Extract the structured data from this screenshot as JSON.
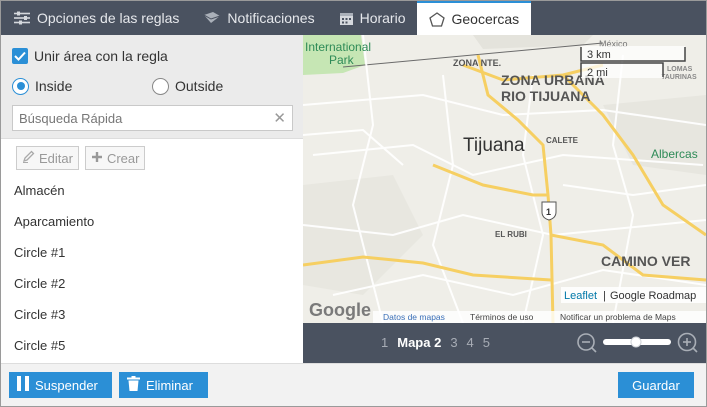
{
  "tabs": [
    {
      "label": "Opciones de las reglas",
      "icon": "sliders-icon",
      "active": false
    },
    {
      "label": "Notificaciones",
      "icon": "envelope-icon",
      "active": false
    },
    {
      "label": "Horario",
      "icon": "calendar-icon",
      "active": false
    },
    {
      "label": "Geocercas",
      "icon": "pentagon-icon",
      "active": true
    }
  ],
  "form": {
    "join_area_label": "Unir área con la regla",
    "join_area_checked": true,
    "inside_label": "Inside",
    "outside_label": "Outside",
    "selected_mode": "inside",
    "search_placeholder": "Búsqueda Rápida"
  },
  "toolbar": {
    "edit_label": "Editar",
    "create_label": "Crear"
  },
  "geofences": [
    {
      "label": "Almacén"
    },
    {
      "label": "Aparcamiento"
    },
    {
      "label": "Circle #1"
    },
    {
      "label": "Circle #2"
    },
    {
      "label": "Circle #3"
    },
    {
      "label": "Circle #5"
    }
  ],
  "map": {
    "labels": {
      "park": "International Park",
      "zona_nte": "ZONA NTE.",
      "zona_urbana": "ZONA URBANA",
      "rio_tijuana": "RIO TIJUANA",
      "tijuana": "Tijuana",
      "calete": "CALETE",
      "el_rubi": "EL RUBI",
      "albercas": "Albercas",
      "camino_ver": "CAMINO VER",
      "lomas": "LOMAS",
      "taurinas": "TAURINAS",
      "mexico": "México",
      "route": "1"
    },
    "scale_km": "3 km",
    "scale_mi": "2 mi",
    "google_logo": "Google",
    "attribution_leaflet": "Leaflet",
    "attribution_sep": "|",
    "attribution_roadmap": "Google Roadmap",
    "data_link": "Datos de mapas",
    "terms_link": "Términos de uso",
    "report_link": "Notificar un problema de Maps"
  },
  "pagination": {
    "pages": [
      "1",
      "Mapa 2",
      "3",
      "4",
      "5"
    ],
    "current_index": 1
  },
  "footer": {
    "suspend_label": "Suspender",
    "delete_label": "Eliminar",
    "save_label": "Guardar"
  },
  "colors": {
    "accent": "#2b8fd6",
    "bar": "#4a5260"
  }
}
